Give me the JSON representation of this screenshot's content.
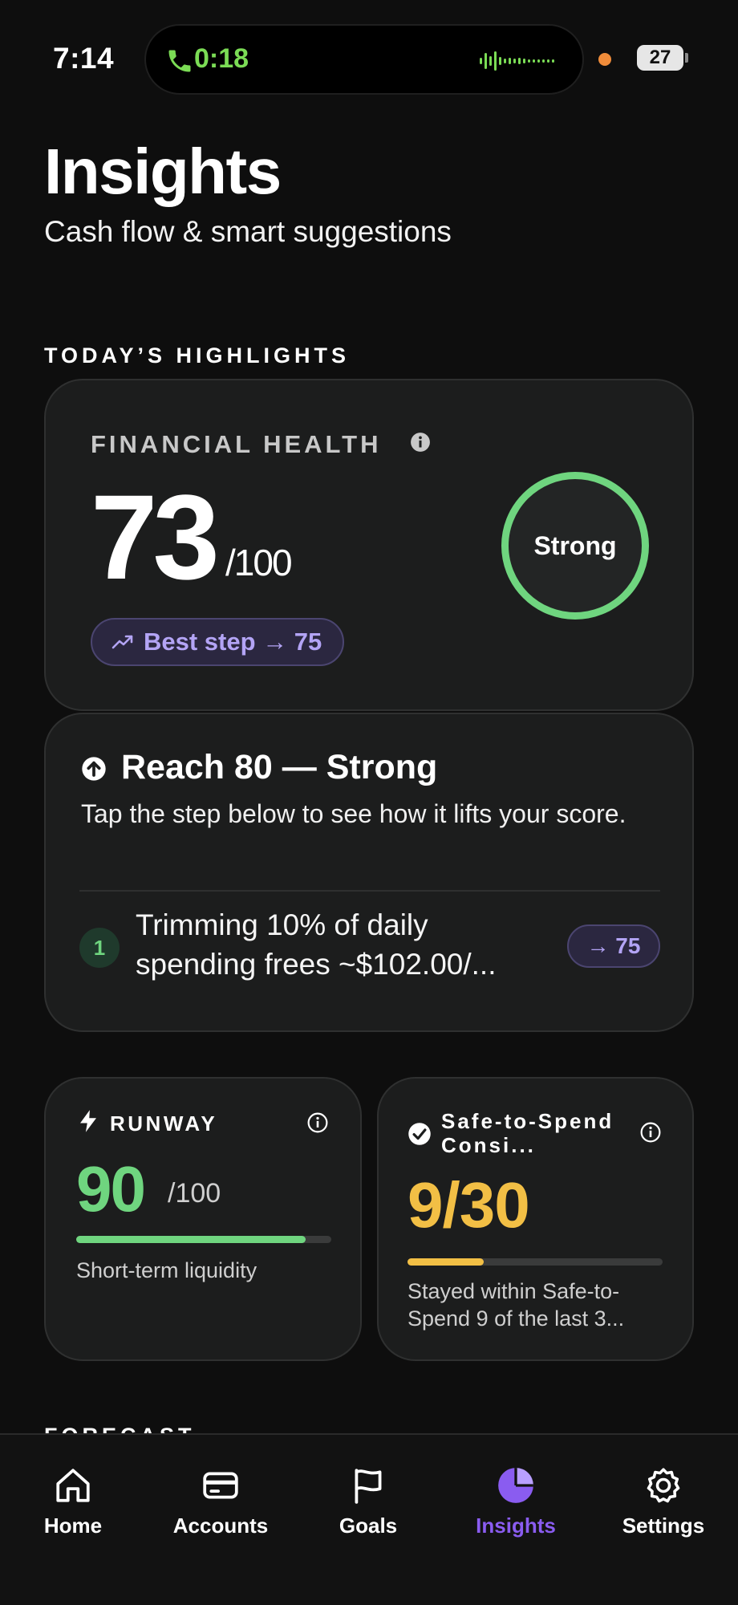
{
  "status_bar": {
    "time": "7:14",
    "call_time": "0:18",
    "battery": "27",
    "colors": {
      "call_green": "#7bdc55",
      "indicator": "#f08c3a"
    }
  },
  "header": {
    "title": "Insights",
    "subtitle": "Cash flow & smart suggestions"
  },
  "highlights": {
    "section_label": "TODAY’S HIGHLIGHTS",
    "financial_health": {
      "label": "FINANCIAL HEALTH",
      "score": "73",
      "max": "/100",
      "status": "Strong",
      "best_step": "Best step → 75",
      "ring_color": "#6fd57f"
    },
    "reach": {
      "title": "Reach 80 — Strong",
      "description": "Tap the step below to see how it lifts your score.",
      "steps": [
        {
          "number": "1",
          "text": "Trimming 10% of daily spending frees ~$102.00/...",
          "badge": "→ 75"
        }
      ]
    },
    "runway": {
      "label": "RUNWAY",
      "score": "90",
      "max": "/100",
      "progress": 0.9,
      "description": "Short-term liquidity",
      "color": "#6fd57f"
    },
    "safe_to_spend": {
      "label": "Safe-to-Spend Consi...",
      "score": "9/30",
      "progress": 0.3,
      "description": "Stayed within Safe-to-Spend 9 of the last 3...",
      "color": "#f2bf45"
    }
  },
  "forecast": {
    "section_label": "FORECAST"
  },
  "tabbar": {
    "active": "Insights",
    "accent": "#8a5cf0",
    "tabs": [
      {
        "label": "Home",
        "icon": "home-icon"
      },
      {
        "label": "Accounts",
        "icon": "card-icon"
      },
      {
        "label": "Goals",
        "icon": "flag-icon"
      },
      {
        "label": "Insights",
        "icon": "pie-chart-icon"
      },
      {
        "label": "Settings",
        "icon": "gear-icon"
      }
    ]
  }
}
